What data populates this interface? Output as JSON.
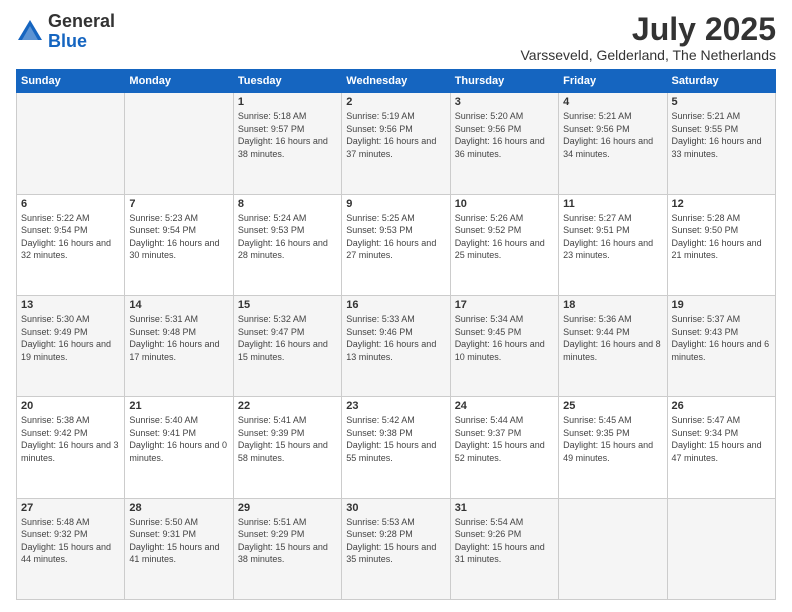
{
  "header": {
    "logo_general": "General",
    "logo_blue": "Blue",
    "main_title": "July 2025",
    "subtitle": "Varsseveld, Gelderland, The Netherlands"
  },
  "calendar": {
    "days_of_week": [
      "Sunday",
      "Monday",
      "Tuesday",
      "Wednesday",
      "Thursday",
      "Friday",
      "Saturday"
    ],
    "weeks": [
      [
        {
          "day": "",
          "info": ""
        },
        {
          "day": "",
          "info": ""
        },
        {
          "day": "1",
          "info": "Sunrise: 5:18 AM\nSunset: 9:57 PM\nDaylight: 16 hours and 38 minutes."
        },
        {
          "day": "2",
          "info": "Sunrise: 5:19 AM\nSunset: 9:56 PM\nDaylight: 16 hours and 37 minutes."
        },
        {
          "day": "3",
          "info": "Sunrise: 5:20 AM\nSunset: 9:56 PM\nDaylight: 16 hours and 36 minutes."
        },
        {
          "day": "4",
          "info": "Sunrise: 5:21 AM\nSunset: 9:56 PM\nDaylight: 16 hours and 34 minutes."
        },
        {
          "day": "5",
          "info": "Sunrise: 5:21 AM\nSunset: 9:55 PM\nDaylight: 16 hours and 33 minutes."
        }
      ],
      [
        {
          "day": "6",
          "info": "Sunrise: 5:22 AM\nSunset: 9:54 PM\nDaylight: 16 hours and 32 minutes."
        },
        {
          "day": "7",
          "info": "Sunrise: 5:23 AM\nSunset: 9:54 PM\nDaylight: 16 hours and 30 minutes."
        },
        {
          "day": "8",
          "info": "Sunrise: 5:24 AM\nSunset: 9:53 PM\nDaylight: 16 hours and 28 minutes."
        },
        {
          "day": "9",
          "info": "Sunrise: 5:25 AM\nSunset: 9:53 PM\nDaylight: 16 hours and 27 minutes."
        },
        {
          "day": "10",
          "info": "Sunrise: 5:26 AM\nSunset: 9:52 PM\nDaylight: 16 hours and 25 minutes."
        },
        {
          "day": "11",
          "info": "Sunrise: 5:27 AM\nSunset: 9:51 PM\nDaylight: 16 hours and 23 minutes."
        },
        {
          "day": "12",
          "info": "Sunrise: 5:28 AM\nSunset: 9:50 PM\nDaylight: 16 hours and 21 minutes."
        }
      ],
      [
        {
          "day": "13",
          "info": "Sunrise: 5:30 AM\nSunset: 9:49 PM\nDaylight: 16 hours and 19 minutes."
        },
        {
          "day": "14",
          "info": "Sunrise: 5:31 AM\nSunset: 9:48 PM\nDaylight: 16 hours and 17 minutes."
        },
        {
          "day": "15",
          "info": "Sunrise: 5:32 AM\nSunset: 9:47 PM\nDaylight: 16 hours and 15 minutes."
        },
        {
          "day": "16",
          "info": "Sunrise: 5:33 AM\nSunset: 9:46 PM\nDaylight: 16 hours and 13 minutes."
        },
        {
          "day": "17",
          "info": "Sunrise: 5:34 AM\nSunset: 9:45 PM\nDaylight: 16 hours and 10 minutes."
        },
        {
          "day": "18",
          "info": "Sunrise: 5:36 AM\nSunset: 9:44 PM\nDaylight: 16 hours and 8 minutes."
        },
        {
          "day": "19",
          "info": "Sunrise: 5:37 AM\nSunset: 9:43 PM\nDaylight: 16 hours and 6 minutes."
        }
      ],
      [
        {
          "day": "20",
          "info": "Sunrise: 5:38 AM\nSunset: 9:42 PM\nDaylight: 16 hours and 3 minutes."
        },
        {
          "day": "21",
          "info": "Sunrise: 5:40 AM\nSunset: 9:41 PM\nDaylight: 16 hours and 0 minutes."
        },
        {
          "day": "22",
          "info": "Sunrise: 5:41 AM\nSunset: 9:39 PM\nDaylight: 15 hours and 58 minutes."
        },
        {
          "day": "23",
          "info": "Sunrise: 5:42 AM\nSunset: 9:38 PM\nDaylight: 15 hours and 55 minutes."
        },
        {
          "day": "24",
          "info": "Sunrise: 5:44 AM\nSunset: 9:37 PM\nDaylight: 15 hours and 52 minutes."
        },
        {
          "day": "25",
          "info": "Sunrise: 5:45 AM\nSunset: 9:35 PM\nDaylight: 15 hours and 49 minutes."
        },
        {
          "day": "26",
          "info": "Sunrise: 5:47 AM\nSunset: 9:34 PM\nDaylight: 15 hours and 47 minutes."
        }
      ],
      [
        {
          "day": "27",
          "info": "Sunrise: 5:48 AM\nSunset: 9:32 PM\nDaylight: 15 hours and 44 minutes."
        },
        {
          "day": "28",
          "info": "Sunrise: 5:50 AM\nSunset: 9:31 PM\nDaylight: 15 hours and 41 minutes."
        },
        {
          "day": "29",
          "info": "Sunrise: 5:51 AM\nSunset: 9:29 PM\nDaylight: 15 hours and 38 minutes."
        },
        {
          "day": "30",
          "info": "Sunrise: 5:53 AM\nSunset: 9:28 PM\nDaylight: 15 hours and 35 minutes."
        },
        {
          "day": "31",
          "info": "Sunrise: 5:54 AM\nSunset: 9:26 PM\nDaylight: 15 hours and 31 minutes."
        },
        {
          "day": "",
          "info": ""
        },
        {
          "day": "",
          "info": ""
        }
      ]
    ]
  }
}
